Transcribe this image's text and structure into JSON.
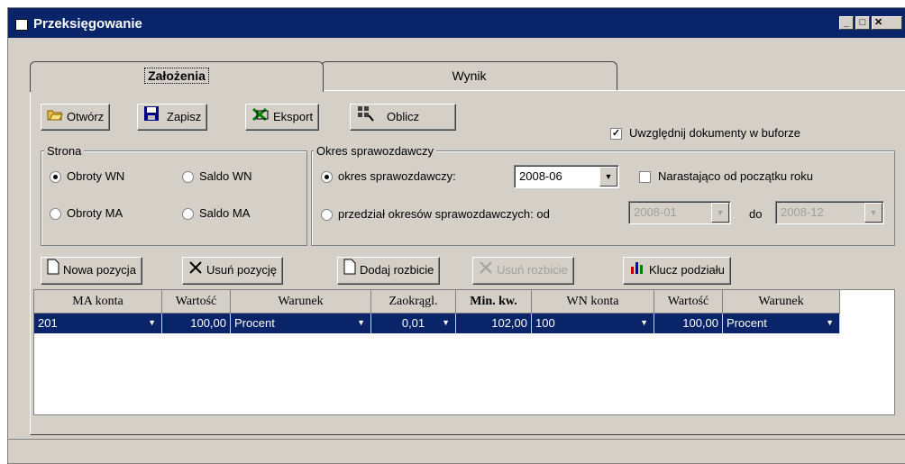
{
  "window": {
    "title": "Przeksięgowanie"
  },
  "tabs": [
    {
      "label": "Założenia"
    },
    {
      "label": "Wynik"
    }
  ],
  "toolbar": {
    "open": "Otwórz",
    "save": "Zapisz",
    "export": "Eksport",
    "calculate": "Oblicz"
  },
  "include_buffer": {
    "label": "Uwzględnij dokumenty w buforze",
    "checked": true
  },
  "strona": {
    "legend": "Strona",
    "options": [
      "Obroty WN",
      "Saldo WN",
      "Obroty MA",
      "Saldo MA"
    ]
  },
  "okres": {
    "legend": "Okres sprawozdawczy",
    "option1": "okres sprawozdawczy:",
    "period_value": "2008-06",
    "cumulative_label": "Narastająco od początku roku",
    "option2": "przedział okresów sprawozdawczych: od",
    "from_value": "2008-01",
    "to_label": "do",
    "to_value": "2008-12"
  },
  "actions": {
    "new_position": "Nowa pozycja",
    "delete_position": "Usuń pozycję",
    "add_split": "Dodaj rozbicie",
    "delete_split": "Usuń rozbicie",
    "split_key": "Klucz podziału"
  },
  "grid": {
    "headers": [
      "MA konta",
      "Wartość",
      "Warunek",
      "Zaokrągl.",
      "Min. kw.",
      "WN konta",
      "Wartość",
      "Warunek"
    ],
    "rows": [
      [
        "201",
        "100,00",
        "Procent",
        "0,01",
        "102,00",
        "100",
        "100,00",
        "Procent"
      ]
    ]
  },
  "colors": {
    "title_bar": "#0a246a",
    "selection": "#0a246a",
    "face": "#d4d0c8"
  }
}
